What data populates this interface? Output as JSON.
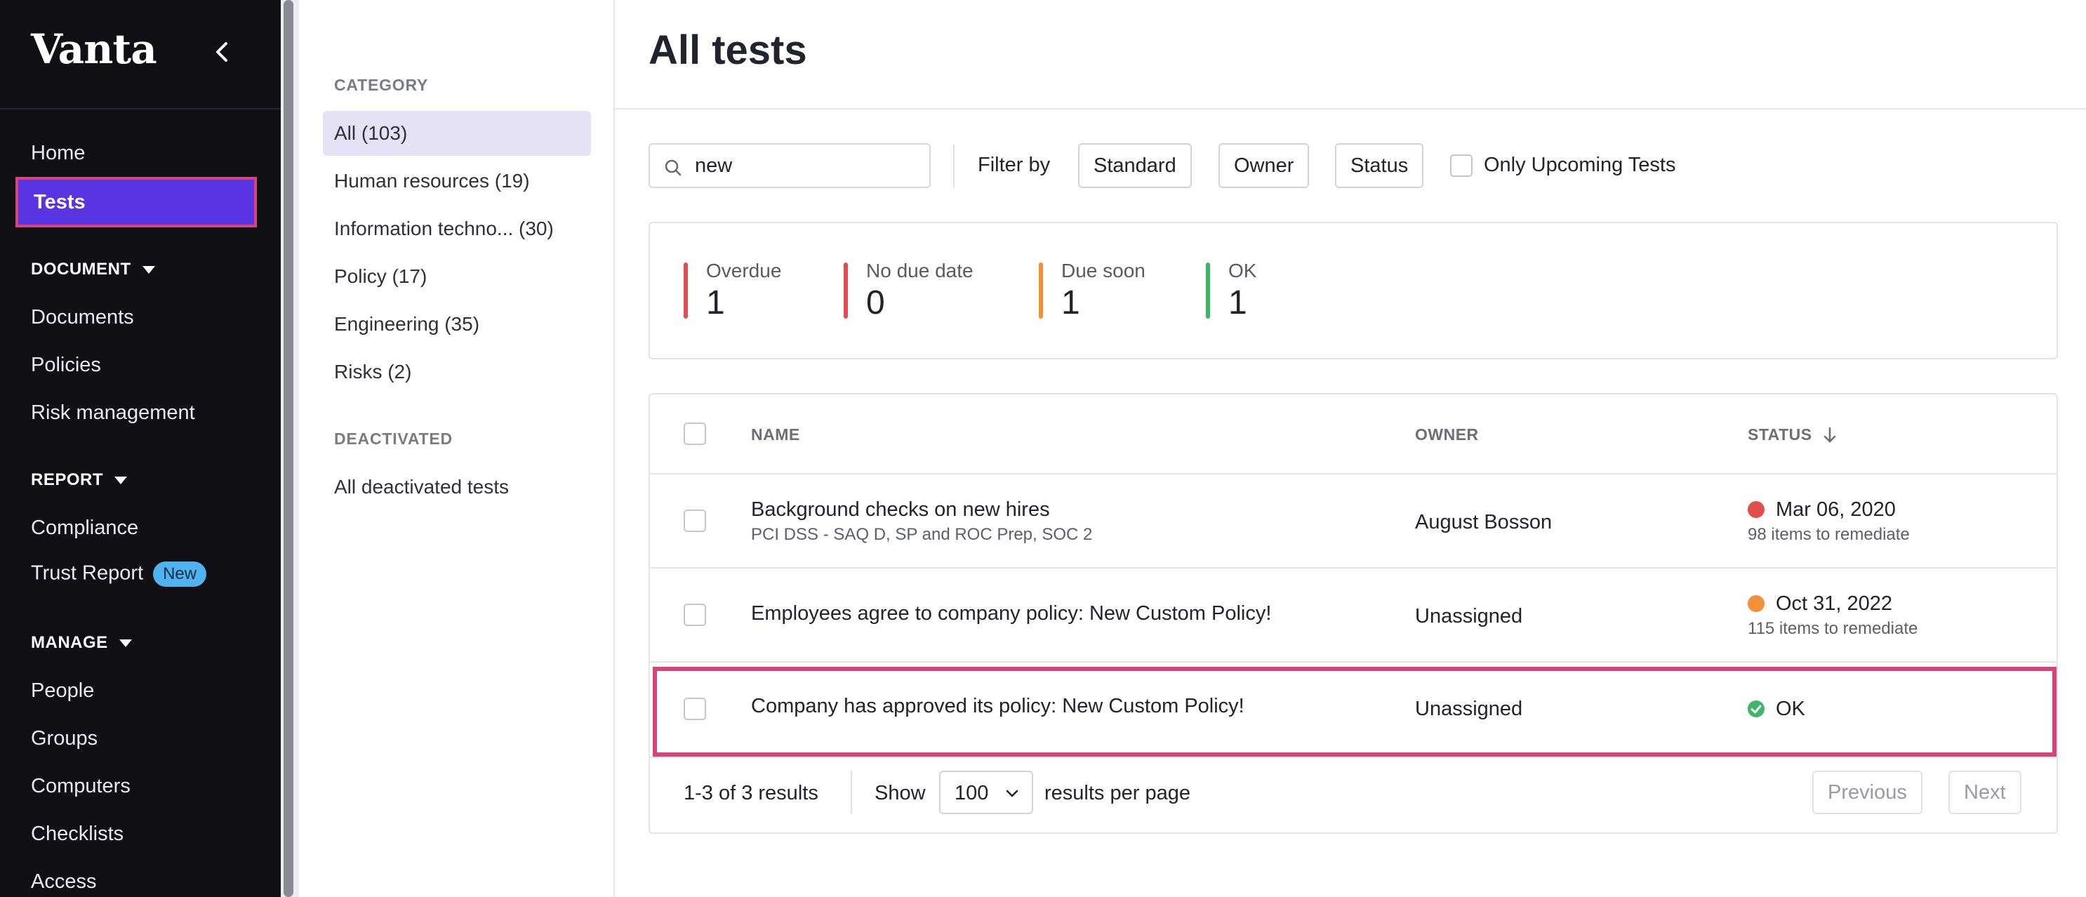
{
  "nav": {
    "brand": "Vanta",
    "items": {
      "home": "Home",
      "tests": "Tests",
      "documents": "Documents",
      "policies": "Policies",
      "risk_management": "Risk management",
      "compliance": "Compliance",
      "trust_report": "Trust Report",
      "trust_report_badge": "New",
      "people": "People",
      "groups": "Groups",
      "computers": "Computers",
      "checklists": "Checklists",
      "access": "Access"
    },
    "sections": {
      "document": "DOCUMENT",
      "report": "REPORT",
      "manage": "MANAGE"
    }
  },
  "categories": {
    "heading": "CATEGORY",
    "items": [
      {
        "label": "All (103)",
        "active": true
      },
      {
        "label": "Human resources (19)"
      },
      {
        "label": "Information techno... (30)"
      },
      {
        "label": "Policy (17)"
      },
      {
        "label": "Engineering (35)"
      },
      {
        "label": "Risks (2)"
      }
    ],
    "deactivated_heading": "DEACTIVATED",
    "deactivated_item": "All deactivated tests"
  },
  "main": {
    "title": "All tests",
    "search": {
      "value": "new",
      "placeholder": ""
    },
    "filter_label": "Filter by",
    "filters": [
      "Standard",
      "Owner",
      "Status"
    ],
    "upcoming_label": "Only Upcoming Tests",
    "summary": [
      {
        "label": "Overdue",
        "value": "1",
        "color": "#e04e4e"
      },
      {
        "label": "No due date",
        "value": "0",
        "color": "#e04e4e"
      },
      {
        "label": "Due soon",
        "value": "1",
        "color": "#f0913a"
      },
      {
        "label": "OK",
        "value": "1",
        "color": "#3fb56a"
      }
    ],
    "table": {
      "headers": {
        "name": "NAME",
        "owner": "OWNER",
        "status": "STATUS"
      },
      "rows": [
        {
          "name": "Background checks on new hires",
          "sub": "PCI DSS - SAQ D, SP and ROC Prep, SOC 2",
          "owner": "August Bosson",
          "status": "Mar 06, 2020",
          "status_sub": "98 items to remediate",
          "status_color": "#e04e4e"
        },
        {
          "name": "Employees agree to company policy: New Custom Policy!",
          "sub": "",
          "owner": "Unassigned",
          "status": "Oct 31, 2022",
          "status_sub": "115 items to remediate",
          "status_color": "#f0913a"
        },
        {
          "name": "Company has approved its policy: New Custom Policy!",
          "sub": "",
          "owner": "Unassigned",
          "status": "OK",
          "status_sub": "",
          "status_color": "#3fb56a"
        }
      ]
    },
    "footer": {
      "results": "1-3 of 3 results",
      "show": "Show",
      "per_page_value": "100",
      "per_page_suffix": "results per page",
      "previous": "Previous",
      "next": "Next"
    }
  },
  "colors": {
    "accent": "#5a34e0",
    "highlight": "#d6457a",
    "nav_bg": "#0f0f14"
  }
}
